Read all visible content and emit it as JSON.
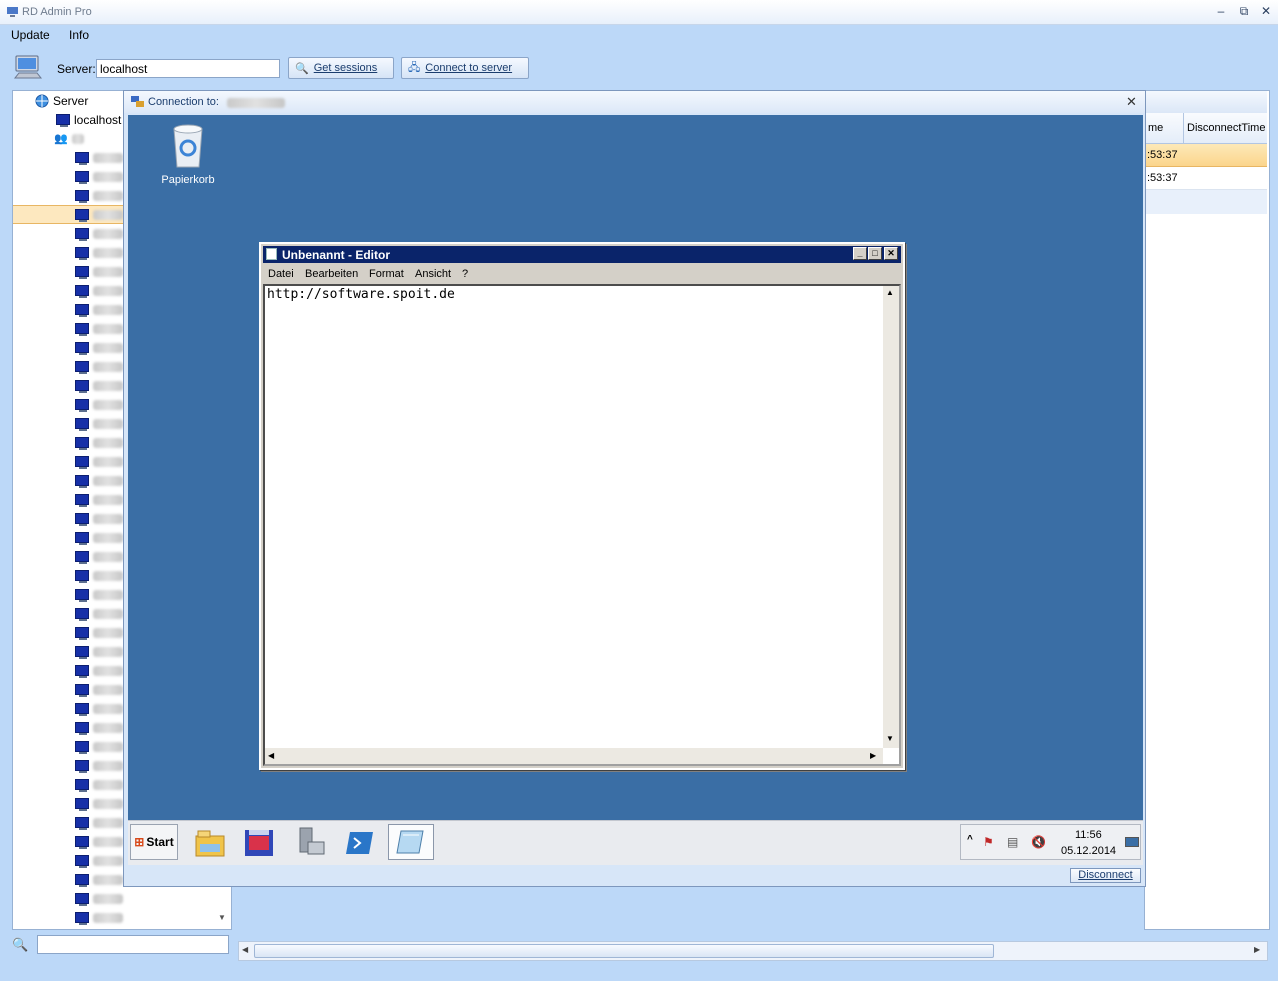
{
  "app": {
    "title": "RD Admin Pro"
  },
  "menu": [
    "Update",
    "Info"
  ],
  "toolbar": {
    "server_label": "Server:",
    "server_value": "localhost",
    "get_sessions": "Get sessions",
    "connect": "Connect to server"
  },
  "tree": {
    "root": "Server",
    "localhost": "localhost"
  },
  "grid": {
    "col1": "me",
    "col2": "DisconnectTime",
    "rows": [
      ":53:37",
      ":53:37"
    ]
  },
  "connection": {
    "title": "Connection to:",
    "disconnect": "Disconnect"
  },
  "desktop": {
    "recycle_bin": "Papierkorb"
  },
  "notepad": {
    "title": "Unbenannt - Editor",
    "menu": [
      "Datei",
      "Bearbeiten",
      "Format",
      "Ansicht",
      "?"
    ],
    "text": "http://software.spoit.de"
  },
  "taskbar": {
    "start": "Start",
    "time": "11:56",
    "date": "05.12.2014"
  },
  "colors": {
    "desktop": "#3a6ea5",
    "selection": "#fde8bf",
    "notepad_title": "#0a246a"
  }
}
